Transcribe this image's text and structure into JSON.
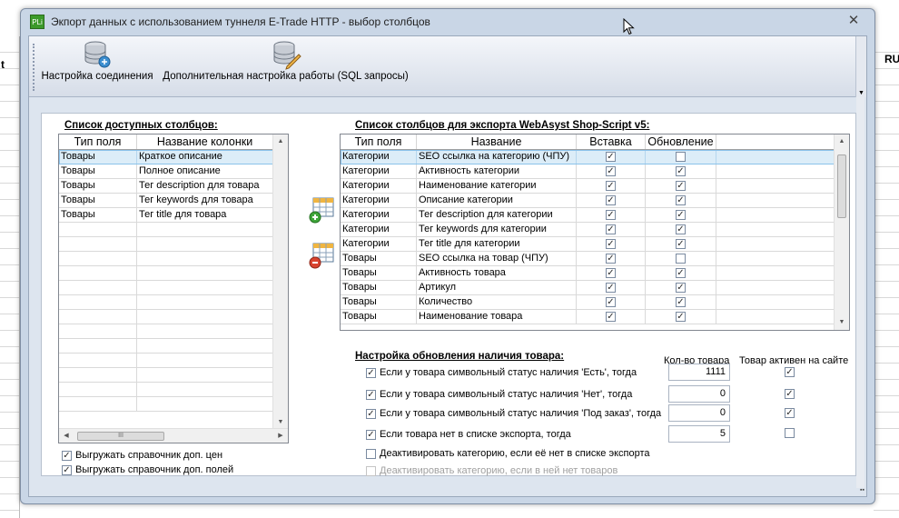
{
  "window": {
    "title": "Экпорт данных с использованием туннеля E-Trade HTTP - выбор столбцов",
    "app_icon_text": "PLi",
    "close_glyph": "✕"
  },
  "background": {
    "peek_left": "t",
    "peek_right": "RU"
  },
  "toolbar": {
    "connection_settings": "Настройка соединения",
    "advanced_settings": "Дополнительная настройка работы (SQL запросы)"
  },
  "available": {
    "title": "Список доступных столбцов:",
    "headers": [
      "Тип поля",
      "Название колонки"
    ],
    "rows": [
      [
        "Товары",
        "Краткое описание"
      ],
      [
        "Товары",
        "Полное описание"
      ],
      [
        "Товары",
        "Тег description для товара"
      ],
      [
        "Товары",
        "Тег keywords для товара"
      ],
      [
        "Товары",
        "Тег title для товара"
      ]
    ],
    "hscroll_thumb": "III"
  },
  "export": {
    "title": "Список столбцов для экспорта WebAsyst Shop-Script v5:",
    "headers": [
      "Тип поля",
      "Название",
      "Вставка",
      "Обновление"
    ],
    "rows": [
      {
        "type": "Категории",
        "name": "SEO ссылка на категорию (ЧПУ)",
        "insert": true,
        "update": false
      },
      {
        "type": "Категории",
        "name": "Активность категории",
        "insert": true,
        "update": true
      },
      {
        "type": "Категории",
        "name": "Наименование категории",
        "insert": true,
        "update": true
      },
      {
        "type": "Категории",
        "name": "Описание категории",
        "insert": true,
        "update": true
      },
      {
        "type": "Категории",
        "name": "Тег description для категории",
        "insert": true,
        "update": true
      },
      {
        "type": "Категории",
        "name": "Тег keywords для категории",
        "insert": true,
        "update": true
      },
      {
        "type": "Категории",
        "name": "Тег title для категории",
        "insert": true,
        "update": true
      },
      {
        "type": "Товары",
        "name": "SEO ссылка на товар (ЧПУ)",
        "insert": true,
        "update": false
      },
      {
        "type": "Товары",
        "name": "Активность товара",
        "insert": true,
        "update": true
      },
      {
        "type": "Товары",
        "name": "Артикул",
        "insert": true,
        "update": true
      },
      {
        "type": "Товары",
        "name": "Количество",
        "insert": true,
        "update": true
      },
      {
        "type": "Товары",
        "name": "Наименование товара",
        "insert": true,
        "update": true
      }
    ]
  },
  "stock": {
    "title": "Настройка обновления наличия товара:",
    "qty_header": "Кол-во товара",
    "active_header": "Товар активен на сайте",
    "rows": [
      {
        "label": "Если у товара символьный статус наличия 'Есть', тогда",
        "checked": true,
        "qty": "1111",
        "active": true
      },
      {
        "label": "Если у товара символьный статус наличия 'Нет', тогда",
        "checked": true,
        "qty": "0",
        "active": true
      },
      {
        "label": "Если у товара символьный статус наличия 'Под заказ', тогда",
        "checked": true,
        "qty": "0",
        "active": true
      },
      {
        "label": "Если товара нет в списке экспорта, тогда",
        "checked": true,
        "qty": "5",
        "active": false
      }
    ],
    "deactivate_missing": "Деактивировать категорию, если её нет в списке экспорта",
    "deactivate_empty": "Деактивировать категорию, если в ней нет товаров"
  },
  "options": {
    "export_prices": "Выгружать справочник доп. цен",
    "export_fields": "Выгружать справочник доп. полей"
  },
  "check_glyph": "✓"
}
